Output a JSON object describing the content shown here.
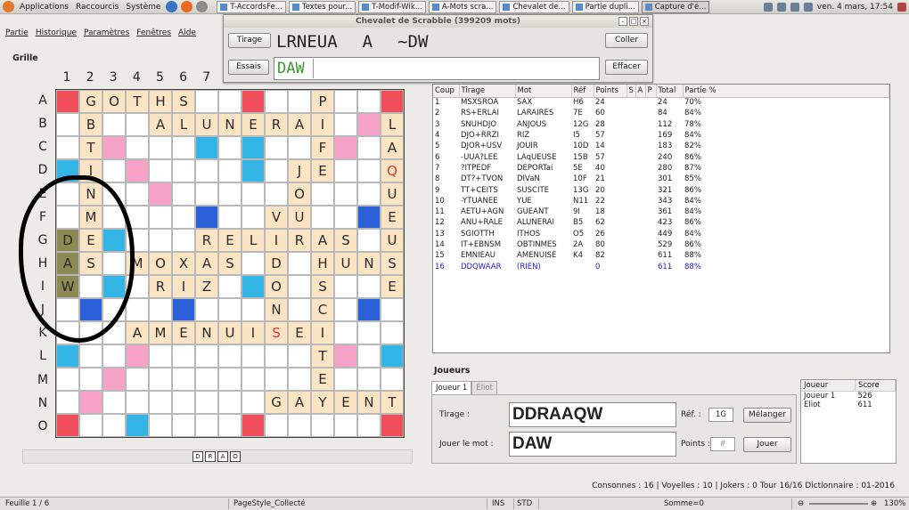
{
  "topbar": {
    "menus": [
      "Applications",
      "Raccourcis",
      "Système"
    ],
    "tasks": [
      "T-AccordsFe...",
      "Textes pour...",
      "T-Modif-Wik...",
      "A-Mots scra...",
      "Chevalet de...",
      "Partie dupli...",
      "Capture d'é..."
    ],
    "clock": "ven. 4 mars, 17:54"
  },
  "menubar": [
    "Partie",
    "Historique",
    "Paramètres",
    "Fenêtres",
    "Aide"
  ],
  "grille_label": "Grille",
  "columns": [
    "1",
    "2",
    "3",
    "4",
    "5",
    "6",
    "7"
  ],
  "rows": [
    "A",
    "B",
    "C",
    "D",
    "E",
    "F",
    "G",
    "H",
    "I",
    "J",
    "K",
    "L",
    "M",
    "N",
    "O"
  ],
  "board": [
    [
      "tw:",
      "tile:G",
      "tile:O",
      "tile:T",
      "tile:H",
      "tile:S",
      "",
      "",
      "tw:",
      "",
      "",
      "tile:P",
      "",
      "",
      "tw:"
    ],
    [
      "",
      "tile:B",
      "",
      "",
      "tile:A",
      "tile:L",
      "tile:U",
      "tile:N",
      "tile:E",
      "tile:R",
      "tile:A",
      "tile:I",
      "",
      "dw:",
      "tile:L"
    ],
    [
      "",
      "tile:T",
      "dw:",
      "",
      "",
      "",
      "dl:",
      "",
      "dl:",
      "",
      "",
      "tile:F",
      "dw:",
      "",
      "tile:A"
    ],
    [
      "dl:",
      "tile:I",
      "",
      "dw:",
      "",
      "",
      "",
      "",
      "dl:",
      "",
      "tile:J",
      "tile:E",
      "",
      "",
      "tile:Q"
    ],
    [
      "",
      "tile:N",
      "",
      "",
      "dw:",
      "",
      "",
      "",
      "",
      "",
      "tile:O",
      "",
      "",
      "",
      "tile:U"
    ],
    [
      "",
      "tile:M",
      "",
      "",
      "",
      "",
      "tl:",
      "",
      "",
      "tile:V",
      "tile:U",
      "",
      "",
      "tl:",
      "tile:E"
    ],
    [
      "sel:D",
      "tile:E",
      "dl:",
      "",
      "",
      "",
      "tile:R",
      "tile:E",
      "tile:L",
      "tile:I",
      "tile:R",
      "tile:A",
      "tile:S",
      "",
      "tile:U"
    ],
    [
      "sel:A",
      "tile:S",
      "",
      "tile:M",
      "tile:O",
      "tile:X",
      "tile:A",
      "tile:S",
      "",
      "tile:D",
      "",
      "tile:H",
      "tile:U",
      "tile:N",
      "tile:S"
    ],
    [
      "sel:W",
      "",
      "dl:",
      "",
      "tile:R",
      "tile:I",
      "tile:Z",
      "",
      "dl:",
      "tile:O",
      "",
      "tile:S",
      "",
      "",
      "tile:E"
    ],
    [
      "",
      "tl:",
      "",
      "",
      "",
      "tl:",
      "",
      "",
      "",
      "tile:N",
      "",
      "tile:C",
      "",
      "tl:",
      ""
    ],
    [
      "",
      "",
      "",
      "tile:A",
      "tile:M",
      "tile:E",
      "tile:N",
      "tile:U",
      "tile:I",
      "tile:S",
      "tile:E",
      "tile:I",
      "",
      "",
      ""
    ],
    [
      "dl:",
      "",
      "",
      "dw:",
      "",
      "",
      "",
      "",
      "",
      "",
      "",
      "tile:T",
      "dw:",
      "",
      "dl:"
    ],
    [
      "",
      "",
      "dw:",
      "",
      "",
      "",
      "",
      "",
      "",
      "",
      "",
      "tile:E",
      "",
      "",
      ""
    ],
    [
      "",
      "dw:",
      "",
      "",
      "",
      "",
      "",
      "",
      "",
      "tile:G",
      "tile:A",
      "tile:Y",
      "tile:E",
      "tile:N",
      "tile:T"
    ],
    [
      "tw:",
      "",
      "",
      "dl:",
      "",
      "",
      "",
      "",
      "tw:",
      "",
      "",
      "",
      "",
      "",
      "tw:"
    ]
  ],
  "mini_rack": [
    "D",
    "R",
    "A",
    "O"
  ],
  "chevalet": {
    "title": "Chevalet de Scrabble (399209 mots)",
    "tirage_button": "Tirage",
    "essais_button": "Essais",
    "coller_button": "Coller",
    "effacer_button": "Effacer",
    "tirage_parts": [
      "LRNEUA",
      "A",
      "~DW"
    ],
    "essais_value": "DAW"
  },
  "moves": {
    "headers": [
      "Coup",
      "Tirage",
      "Mot",
      "Réf",
      "Points",
      "S",
      "A",
      "P",
      "Total",
      "Partie %"
    ],
    "rows": [
      [
        "1",
        "MSXSROA",
        "SAX",
        "H6",
        "24",
        "",
        "",
        "",
        "24",
        "70%"
      ],
      [
        "2",
        "RS+ERLAI",
        "LARAIRES",
        "7E",
        "60",
        "",
        "",
        "",
        "84",
        "84%"
      ],
      [
        "3",
        "SNUHDJO",
        "ANJOUS",
        "12G",
        "28",
        "",
        "",
        "",
        "112",
        "78%"
      ],
      [
        "4",
        "DJO+RRZI",
        "RIZ",
        "I5",
        "57",
        "",
        "",
        "",
        "169",
        "84%"
      ],
      [
        "5",
        "DJOR+USV",
        "JOUIR",
        "10D",
        "14",
        "",
        "",
        "",
        "183",
        "82%"
      ],
      [
        "6",
        "-UUA?LEE",
        "LAqUEUSE",
        "15B",
        "57",
        "",
        "",
        "",
        "240",
        "86%"
      ],
      [
        "7",
        "?ITPEDF",
        "DEPORTai",
        "5E",
        "40",
        "",
        "",
        "",
        "280",
        "87%"
      ],
      [
        "8",
        "DT?+TVON",
        "DIVaN",
        "10F",
        "21",
        "",
        "",
        "",
        "301",
        "85%"
      ],
      [
        "9",
        "TT+CEITS",
        "SUSCITE",
        "13G",
        "20",
        "",
        "",
        "",
        "321",
        "86%"
      ],
      [
        "10",
        "-YTUANEE",
        "YUE",
        "N11",
        "22",
        "",
        "",
        "",
        "343",
        "84%"
      ],
      [
        "11",
        "AETU+AGN",
        "GUEANT",
        "9I",
        "18",
        "",
        "",
        "",
        "361",
        "84%"
      ],
      [
        "12",
        "ANU+RALE",
        "ALUNERAI",
        "B5",
        "62",
        "",
        "",
        "",
        "423",
        "86%"
      ],
      [
        "13",
        "SGIOTTH",
        "ITHOS",
        "O5",
        "26",
        "",
        "",
        "",
        "449",
        "84%"
      ],
      [
        "14",
        "IT+EBNSM",
        "OBTINMES",
        "2A",
        "80",
        "",
        "",
        "",
        "529",
        "86%"
      ],
      [
        "15",
        "EMNIEAU",
        "AMENUISE",
        "K4",
        "82",
        "",
        "",
        "",
        "611",
        "88%"
      ],
      [
        "16",
        "DDQWAAR",
        "(RIEN)",
        "",
        "0",
        "",
        "",
        "",
        "611",
        "88%"
      ]
    ]
  },
  "joueurs": {
    "title": "Joueurs",
    "tabs": [
      "Joueur 1",
      "Eliot"
    ],
    "tirage_label": "Tirage :",
    "tirage_value": "DDRAAQW",
    "ref_label": "Réf. :",
    "ref_value": "1G",
    "melanger_button": "Mélanger",
    "jouer_label": "Jouer le mot :",
    "jouer_value": "DAW",
    "points_label": "Points :",
    "points_value": "#",
    "jouer_button": "Jouer"
  },
  "scores": {
    "headers": [
      "Joueur",
      "Score"
    ],
    "rows": [
      [
        "Joueur 1",
        "526"
      ],
      [
        "Eliot",
        "611"
      ]
    ]
  },
  "info": "Consonnes : 16 | Voyelles : 10 | Jokers : 0  Tour 16/16  Dictionnaire : 01-2016",
  "status": {
    "feuille": "Feuille 1 / 6",
    "pagestyle": "PageStyle_Collecté",
    "ins": "INS",
    "std": "STD",
    "somme": "Somme=0",
    "zoom": "130%"
  }
}
